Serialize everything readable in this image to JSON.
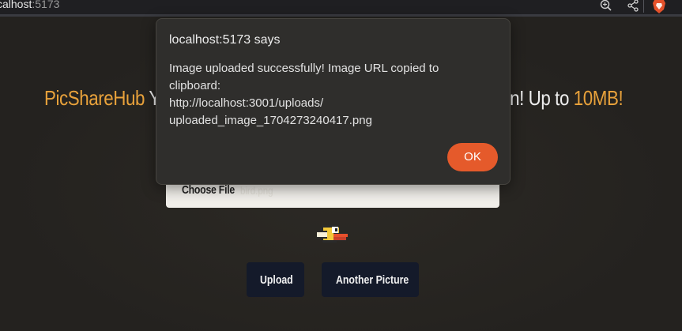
{
  "browser": {
    "url_host": "calhost",
    "url_port": ":5173",
    "icons": [
      "zoom-icon",
      "share-icon",
      "brave-shield-icon"
    ]
  },
  "page": {
    "hero": {
      "brand": "PicShareHub",
      "lead": " Y",
      "tail_plain": "n! Up to ",
      "tail_accent": "10MB!"
    },
    "file_input": {
      "button_label": "Choose File",
      "file_name": "bird.png"
    },
    "buttons": {
      "upload": "Upload",
      "another": "Another Picture"
    },
    "colors": {
      "accent": "#e9a23b",
      "background": "#24221f",
      "button_bg": "#141a2a",
      "ok_button": "#e55a2b"
    }
  },
  "dialog": {
    "title": "localhost:5173 says",
    "message_lines": [
      "Image uploaded successfully! Image URL copied to",
      "clipboard:",
      "http://localhost:3001/uploads/",
      "uploaded_image_1704273240417.png"
    ],
    "ok_label": "OK"
  }
}
